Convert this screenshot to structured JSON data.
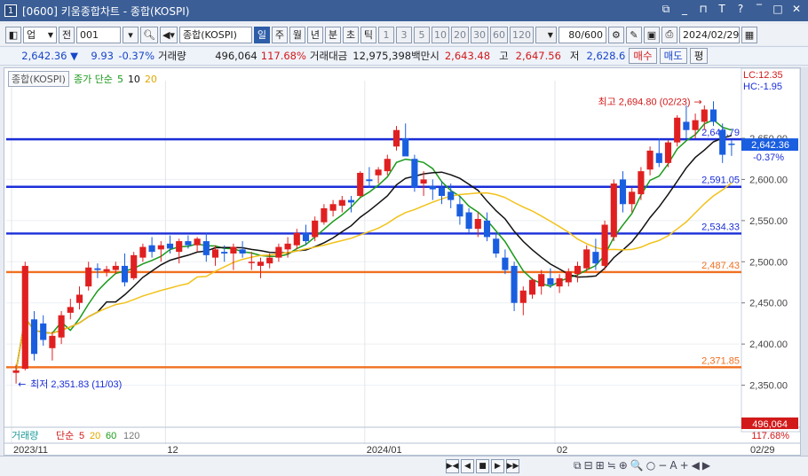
{
  "window": {
    "screen_number": "1",
    "title": "[0600] 키움종합차트 - 종합(KOSPI)",
    "controls": [
      "⧉",
      "_",
      "⊓",
      "T",
      "?",
      "‾",
      "□",
      "✕"
    ]
  },
  "toolbar1": {
    "market_type": "업",
    "prev_label": "전",
    "code": "001",
    "index_name": "종합(KOSPI)",
    "periods": [
      "일",
      "주",
      "월",
      "년",
      "분",
      "초",
      "틱"
    ],
    "selected_period": "일",
    "intervals": [
      "1",
      "3",
      "5",
      "10",
      "20",
      "30",
      "60",
      "120"
    ],
    "count": "80/600",
    "date": "2024/02/29"
  },
  "toolbar2": {
    "price": "2,642.36",
    "change": "9.93",
    "change_pct": "-0.37%",
    "volume_label": "거래량",
    "volume": "496,064",
    "volume_ratio": "117.68%",
    "amount_label": "거래대금",
    "amount": "12,975,398백만",
    "open_label": "시",
    "open": "2,643.48",
    "high_label": "고",
    "high": "2,647.56",
    "low_label": "저",
    "low": "2,628.6",
    "buy_label": "매수",
    "sell_label": "매도",
    "eval_label": "평"
  },
  "legend": {
    "index_name": "종합(KOSPI)",
    "ma_label": "종가 단순",
    "ma_periods": [
      "5",
      "10",
      "20"
    ]
  },
  "volume_legend": {
    "label": "거래량",
    "ma_label": "단순",
    "periods": [
      "5",
      "20",
      "60",
      "120"
    ]
  },
  "right_info": {
    "lc": "LC:12.35",
    "hc": "HC:-1.95",
    "current_price": "2,642.36",
    "current_pct": "-0.37%",
    "volume_value": "496,064",
    "volume_pct": "117.68%"
  },
  "chart_data": {
    "type": "candlestick",
    "y_axis_ticks": [
      "2,650.00",
      "2,600.00",
      "2,550.00",
      "2,500.00",
      "2,450.00",
      "2,400.00",
      "2,350.00"
    ],
    "ylim": [
      2300,
      2720
    ],
    "x_axis_labels": [
      "2023/11",
      "12",
      "2024/01",
      "02"
    ],
    "x_axis_right_label": "02/29",
    "high_annotation": "최고 2,694.80 (02/23)",
    "low_annotation": "최저 2,351.83 (11/03)",
    "horizontal_lines": [
      {
        "value": 2648.79,
        "label": "2,648.79",
        "color": "#1a2ed8"
      },
      {
        "value": 2591.05,
        "label": "2,591.05",
        "color": "#1a2ed8"
      },
      {
        "value": 2534.33,
        "label": "2,534.33",
        "color": "#1a2ed8"
      },
      {
        "value": 2487.43,
        "label": "2,487.43",
        "color": "#f07020"
      },
      {
        "value": 2371.85,
        "label": "2,371.85",
        "color": "#f07020"
      }
    ],
    "candles": [
      [
        2365,
        2375,
        2352,
        2368
      ],
      [
        2370,
        2500,
        2368,
        2495
      ],
      [
        2430,
        2440,
        2380,
        2388
      ],
      [
        2425,
        2435,
        2398,
        2405
      ],
      [
        2395,
        2415,
        2380,
        2410
      ],
      [
        2408,
        2440,
        2400,
        2435
      ],
      [
        2438,
        2455,
        2430,
        2445
      ],
      [
        2450,
        2470,
        2442,
        2460
      ],
      [
        2470,
        2500,
        2465,
        2493
      ],
      [
        2492,
        2498,
        2480,
        2490
      ],
      [
        2488,
        2495,
        2482,
        2491
      ],
      [
        2490,
        2500,
        2485,
        2495
      ],
      [
        2495,
        2510,
        2470,
        2475
      ],
      [
        2480,
        2512,
        2478,
        2508
      ],
      [
        2505,
        2522,
        2500,
        2518
      ],
      [
        2520,
        2530,
        2505,
        2512
      ],
      [
        2515,
        2525,
        2500,
        2520
      ],
      [
        2522,
        2532,
        2510,
        2516
      ],
      [
        2512,
        2528,
        2498,
        2525
      ],
      [
        2525,
        2532,
        2516,
        2520
      ],
      [
        2520,
        2530,
        2512,
        2528
      ],
      [
        2525,
        2535,
        2500,
        2508
      ],
      [
        2505,
        2520,
        2495,
        2515
      ],
      [
        2512,
        2520,
        2500,
        2510
      ],
      [
        2510,
        2522,
        2490,
        2518
      ],
      [
        2515,
        2525,
        2505,
        2510
      ],
      [
        2500,
        2512,
        2490,
        2500
      ],
      [
        2495,
        2505,
        2480,
        2500
      ],
      [
        2498,
        2510,
        2492,
        2505
      ],
      [
        2505,
        2522,
        2500,
        2518
      ],
      [
        2515,
        2530,
        2505,
        2522
      ],
      [
        2520,
        2540,
        2515,
        2535
      ],
      [
        2535,
        2545,
        2520,
        2525
      ],
      [
        2530,
        2555,
        2525,
        2550
      ],
      [
        2548,
        2570,
        2545,
        2565
      ],
      [
        2562,
        2575,
        2555,
        2570
      ],
      [
        2568,
        2580,
        2560,
        2575
      ],
      [
        2575,
        2580,
        2560,
        2572
      ],
      [
        2580,
        2610,
        2578,
        2608
      ],
      [
        2600,
        2615,
        2590,
        2598
      ],
      [
        2605,
        2615,
        2595,
        2612
      ],
      [
        2610,
        2630,
        2605,
        2625
      ],
      [
        2640,
        2665,
        2635,
        2660
      ],
      [
        2650,
        2668,
        2640,
        2628
      ],
      [
        2625,
        2630,
        2585,
        2590
      ],
      [
        2595,
        2610,
        2580,
        2600
      ],
      [
        2592,
        2600,
        2575,
        2588
      ],
      [
        2590,
        2598,
        2570,
        2580
      ],
      [
        2585,
        2595,
        2565,
        2575
      ],
      [
        2570,
        2580,
        2545,
        2555
      ],
      [
        2560,
        2565,
        2535,
        2540
      ],
      [
        2540,
        2560,
        2530,
        2552
      ],
      [
        2550,
        2560,
        2525,
        2530
      ],
      [
        2528,
        2535,
        2505,
        2510
      ],
      [
        2505,
        2515,
        2485,
        2490
      ],
      [
        2495,
        2500,
        2440,
        2450
      ],
      [
        2450,
        2470,
        2435,
        2465
      ],
      [
        2460,
        2480,
        2455,
        2478
      ],
      [
        2470,
        2490,
        2460,
        2485
      ],
      [
        2480,
        2492,
        2468,
        2472
      ],
      [
        2470,
        2485,
        2462,
        2480
      ],
      [
        2475,
        2492,
        2470,
        2488
      ],
      [
        2485,
        2500,
        2475,
        2495
      ],
      [
        2492,
        2520,
        2488,
        2515
      ],
      [
        2512,
        2528,
        2490,
        2498
      ],
      [
        2495,
        2550,
        2490,
        2545
      ],
      [
        2530,
        2600,
        2525,
        2595
      ],
      [
        2600,
        2610,
        2560,
        2570
      ],
      [
        2570,
        2590,
        2560,
        2585
      ],
      [
        2582,
        2615,
        2575,
        2610
      ],
      [
        2612,
        2640,
        2605,
        2635
      ],
      [
        2632,
        2650,
        2615,
        2620
      ],
      [
        2620,
        2648,
        2615,
        2645
      ],
      [
        2645,
        2678,
        2640,
        2675
      ],
      [
        2670,
        2690,
        2650,
        2660
      ],
      [
        2660,
        2680,
        2650,
        2672
      ],
      [
        2670,
        2690,
        2660,
        2685
      ],
      [
        2685,
        2695,
        2665,
        2670
      ],
      [
        2660,
        2668,
        2620,
        2630
      ],
      [
        2643.48,
        2647.56,
        2628.6,
        2642.36
      ]
    ]
  },
  "colors": {
    "up": "#e02020",
    "down": "#1a5ee0",
    "ma5": "#1a9a1a",
    "ma10": "#111111",
    "ma20": "#f2c21a",
    "title_bar": "#3b5e96",
    "selected": "#2f5ea8"
  },
  "bottom": {
    "nav_icons": [
      "▶◀",
      "◀",
      "■",
      "▶",
      "▶▶"
    ],
    "tool_icons": [
      "⧉",
      "⊟",
      "⊞",
      "≒",
      "⊕",
      "🔍",
      "○",
      "−",
      "A",
      "+",
      "◀",
      "▶"
    ]
  }
}
